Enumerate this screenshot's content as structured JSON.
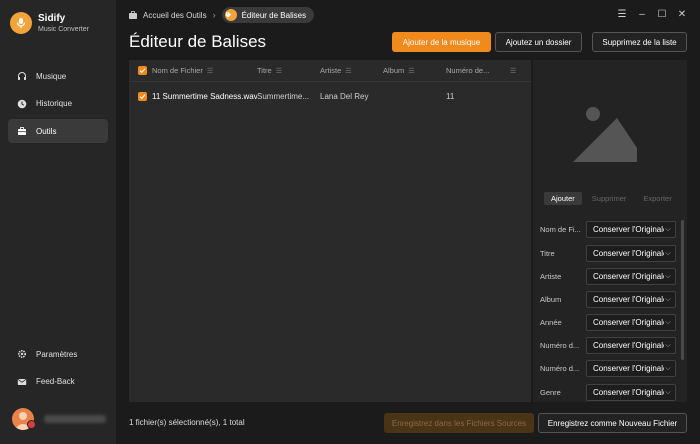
{
  "brand": {
    "name": "Sidify",
    "subtitle": "Music Converter",
    "accent": "#f08a1c"
  },
  "sidebar": {
    "items": [
      {
        "label": "Musique",
        "icon": "headphones-icon",
        "active": false
      },
      {
        "label": "Historique",
        "icon": "clock-icon",
        "active": false
      },
      {
        "label": "Outils",
        "icon": "toolbox-icon",
        "active": true
      }
    ],
    "bottom_items": [
      {
        "label": "Paramètres",
        "icon": "gear-icon"
      },
      {
        "label": "Feed-Back",
        "icon": "mail-icon"
      }
    ]
  },
  "breadcrumb": {
    "home": "Accueil des Outils",
    "current": "Éditeur de Balises"
  },
  "window_controls": {
    "menu": "☰",
    "minimize": "–",
    "maximize": "☐",
    "close": "✕"
  },
  "page": {
    "title": "Éditeur de Balises"
  },
  "toolbar": {
    "add_music": "Ajouter de la musique",
    "add_folder": "Ajoutez un dossier",
    "clear_list": "Supprimez de la liste"
  },
  "table": {
    "headers": [
      "Nom de Fichier",
      "Titre",
      "Artiste",
      "Album",
      "Numéro de..."
    ],
    "rows": [
      {
        "file": "11 Summertime Sadness.wav",
        "title": "Summertime...",
        "artist": "Lana Del Rey",
        "album": "",
        "number": "11"
      }
    ]
  },
  "cover_panel": {
    "tabs": [
      "Ajouter",
      "Supprimer",
      "Exporter"
    ],
    "fields": [
      {
        "label": "Nom de Fi...",
        "value": "Conserver l'Originale"
      },
      {
        "label": "Titre",
        "value": "Conserver l'Originale"
      },
      {
        "label": "Artiste",
        "value": "Conserver l'Originale"
      },
      {
        "label": "Album",
        "value": "Conserver l'Originale"
      },
      {
        "label": "Année",
        "value": "Conserver l'Originale"
      },
      {
        "label": "Numéro d...",
        "value": "Conserver l'Originale"
      },
      {
        "label": "Numéro d...",
        "value": "Conserver l'Originale"
      },
      {
        "label": "Genre",
        "value": "Conserver l'Originale"
      }
    ]
  },
  "footer": {
    "status": "1 fichier(s) sélectionné(s), 1 total",
    "save_source": "Enregistrez dans les Fichiers Sources",
    "save_new": "Enregistrez comme Nouveau Fichier"
  }
}
